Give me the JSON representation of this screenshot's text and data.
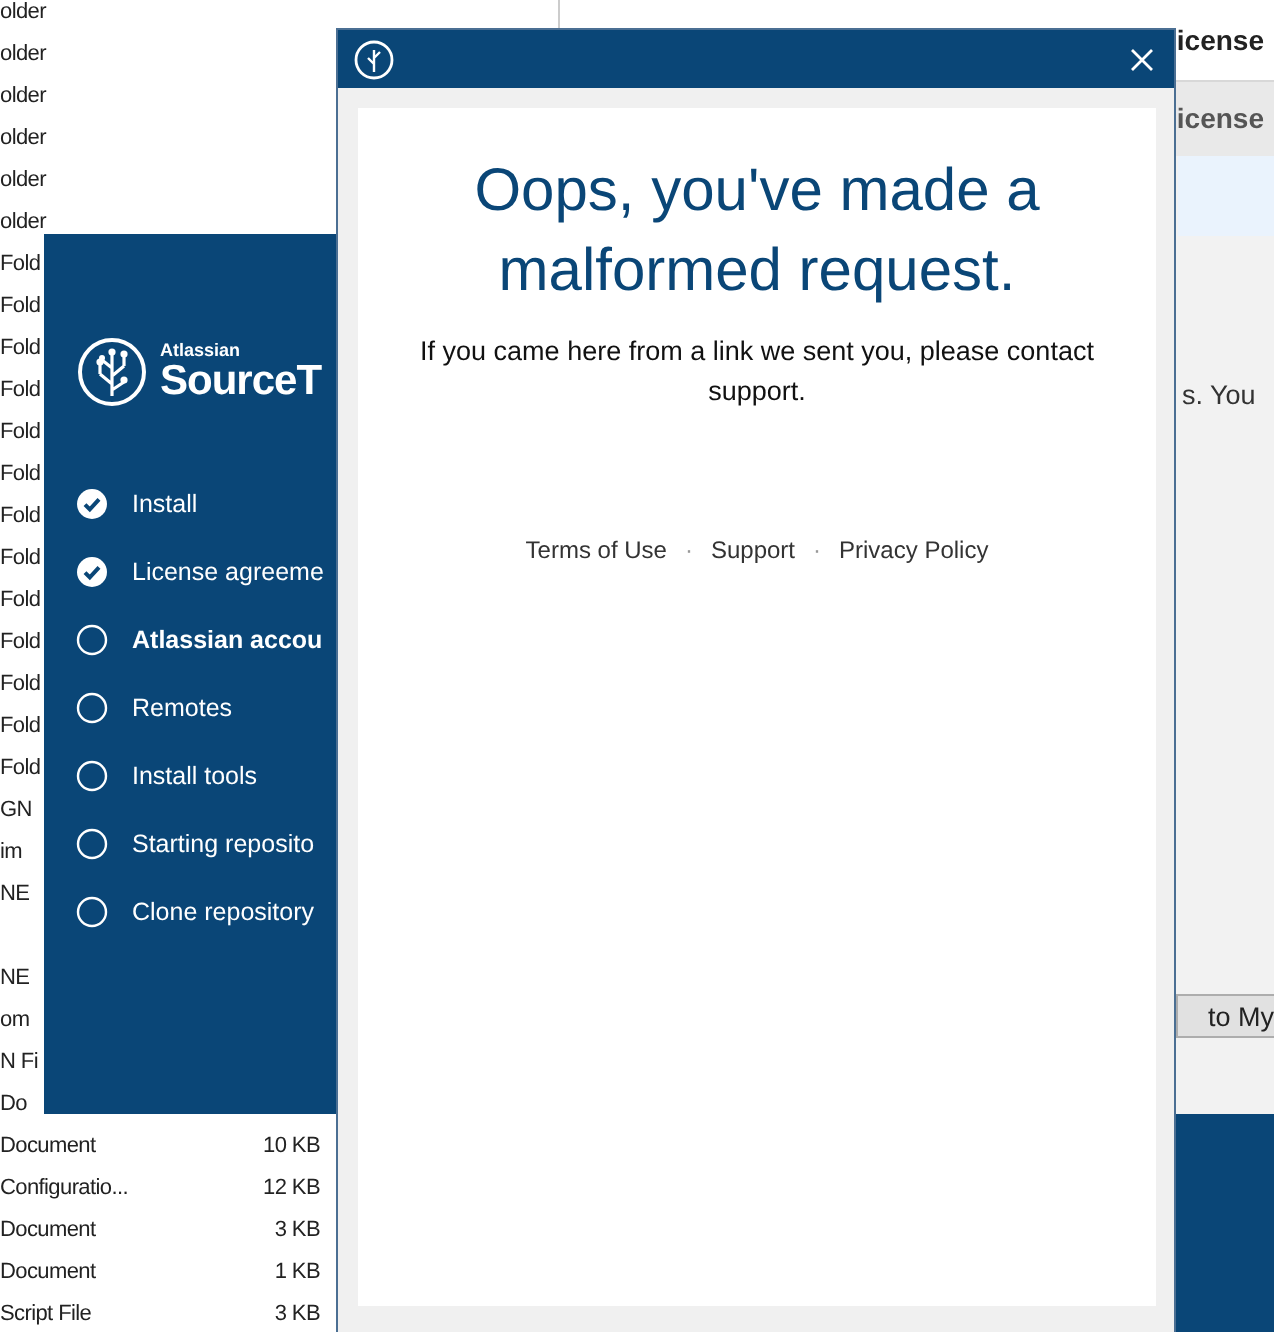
{
  "explorer": {
    "rows": [
      {
        "type": "older"
      },
      {
        "type": "older"
      },
      {
        "type": "older"
      },
      {
        "type": "older"
      },
      {
        "type": "older"
      },
      {
        "type": "older"
      },
      {
        "type": "Fold"
      },
      {
        "type": "Fold"
      },
      {
        "type": "Fold"
      },
      {
        "type": "Fold"
      },
      {
        "type": "Fold"
      },
      {
        "type": "Fold"
      },
      {
        "type": "Fold"
      },
      {
        "type": "Fold"
      },
      {
        "type": "Fold"
      },
      {
        "type": "Fold"
      },
      {
        "type": "Fold"
      },
      {
        "type": "Fold"
      },
      {
        "type": "Fold"
      },
      {
        "type": "GN"
      },
      {
        "type": "im"
      },
      {
        "type": "NE"
      },
      {},
      {
        "type": "NE"
      },
      {
        "type": "om"
      },
      {
        "type": "N Fi"
      },
      {
        "type": "Do"
      },
      {
        "type": "Document",
        "size": "10 KB"
      },
      {
        "type": "Configuratio...",
        "size": "12 KB"
      },
      {
        "type": "Document",
        "size": "3 KB"
      },
      {
        "type": "Document",
        "size": "1 KB"
      },
      {
        "type": "Script File",
        "size": "3 KB"
      }
    ]
  },
  "background_window": {
    "title": "icense",
    "column_header": "icense",
    "body_text": "s. You",
    "button": "to My"
  },
  "installer": {
    "brand": "Atlassian",
    "product": "SourceT",
    "steps": [
      {
        "label": "Install",
        "done": true,
        "current": false
      },
      {
        "label": "License agreeme",
        "done": true,
        "current": false
      },
      {
        "label": "Atlassian accou",
        "done": false,
        "current": true
      },
      {
        "label": "Remotes",
        "done": false,
        "current": false
      },
      {
        "label": "Install tools",
        "done": false,
        "current": false
      },
      {
        "label": "Starting reposito",
        "done": false,
        "current": false
      },
      {
        "label": "Clone repository",
        "done": false,
        "current": false
      }
    ]
  },
  "dialog": {
    "heading": "Oops, you've made a malformed request.",
    "message": "If you came here from a link we sent you, please contact support.",
    "footer": [
      {
        "kind": "link",
        "text": "Terms of Use"
      },
      {
        "kind": "separator",
        "text": "·"
      },
      {
        "kind": "link",
        "text": "Support"
      },
      {
        "kind": "separator",
        "text": "·"
      },
      {
        "kind": "link",
        "text": "Privacy Policy"
      }
    ]
  }
}
